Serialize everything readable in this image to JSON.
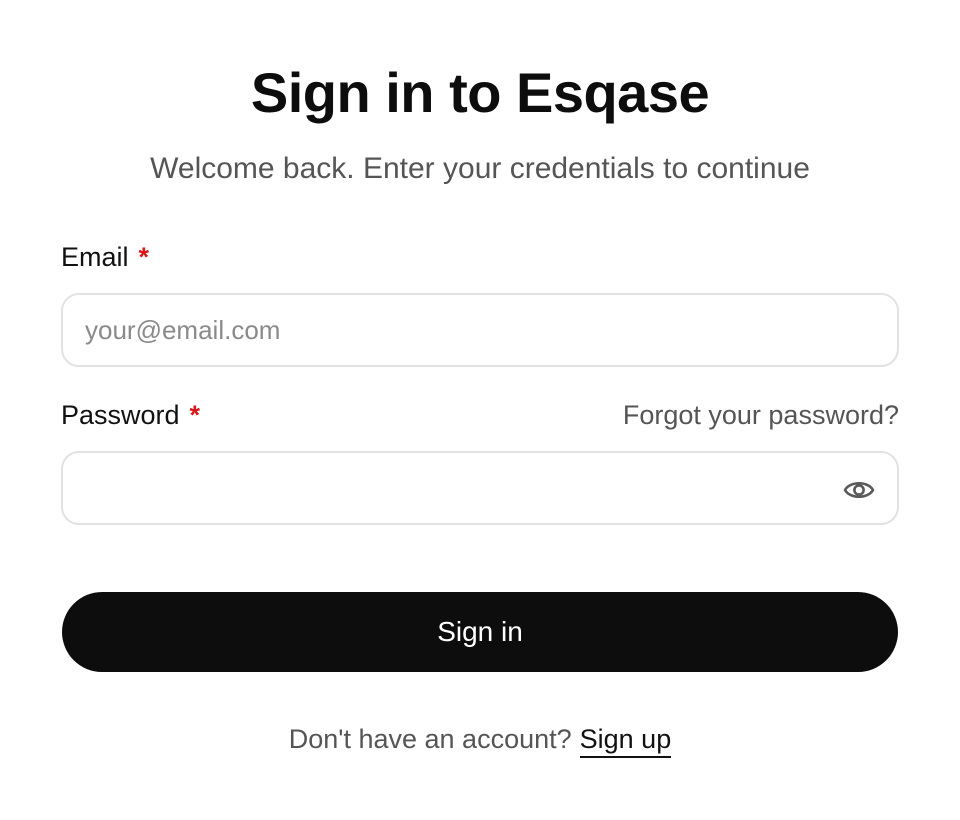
{
  "header": {
    "title": "Sign in to Esqase",
    "subtitle": "Welcome back. Enter your credentials to continue"
  },
  "form": {
    "email": {
      "label": "Email",
      "required_mark": "*",
      "value": "",
      "placeholder": "your@email.com"
    },
    "password": {
      "label": "Password",
      "required_mark": "*",
      "value": "",
      "placeholder": "",
      "forgot_link": "Forgot your password?",
      "toggle_icon": "eye-icon"
    },
    "submit_label": "Sign in"
  },
  "footer": {
    "prompt": "Don't have an account?",
    "signup_link": "Sign up"
  },
  "colors": {
    "primary": "#0d0d0d",
    "required": "#d9161a",
    "muted_text": "#555555",
    "input_border": "#e2e2e2"
  }
}
